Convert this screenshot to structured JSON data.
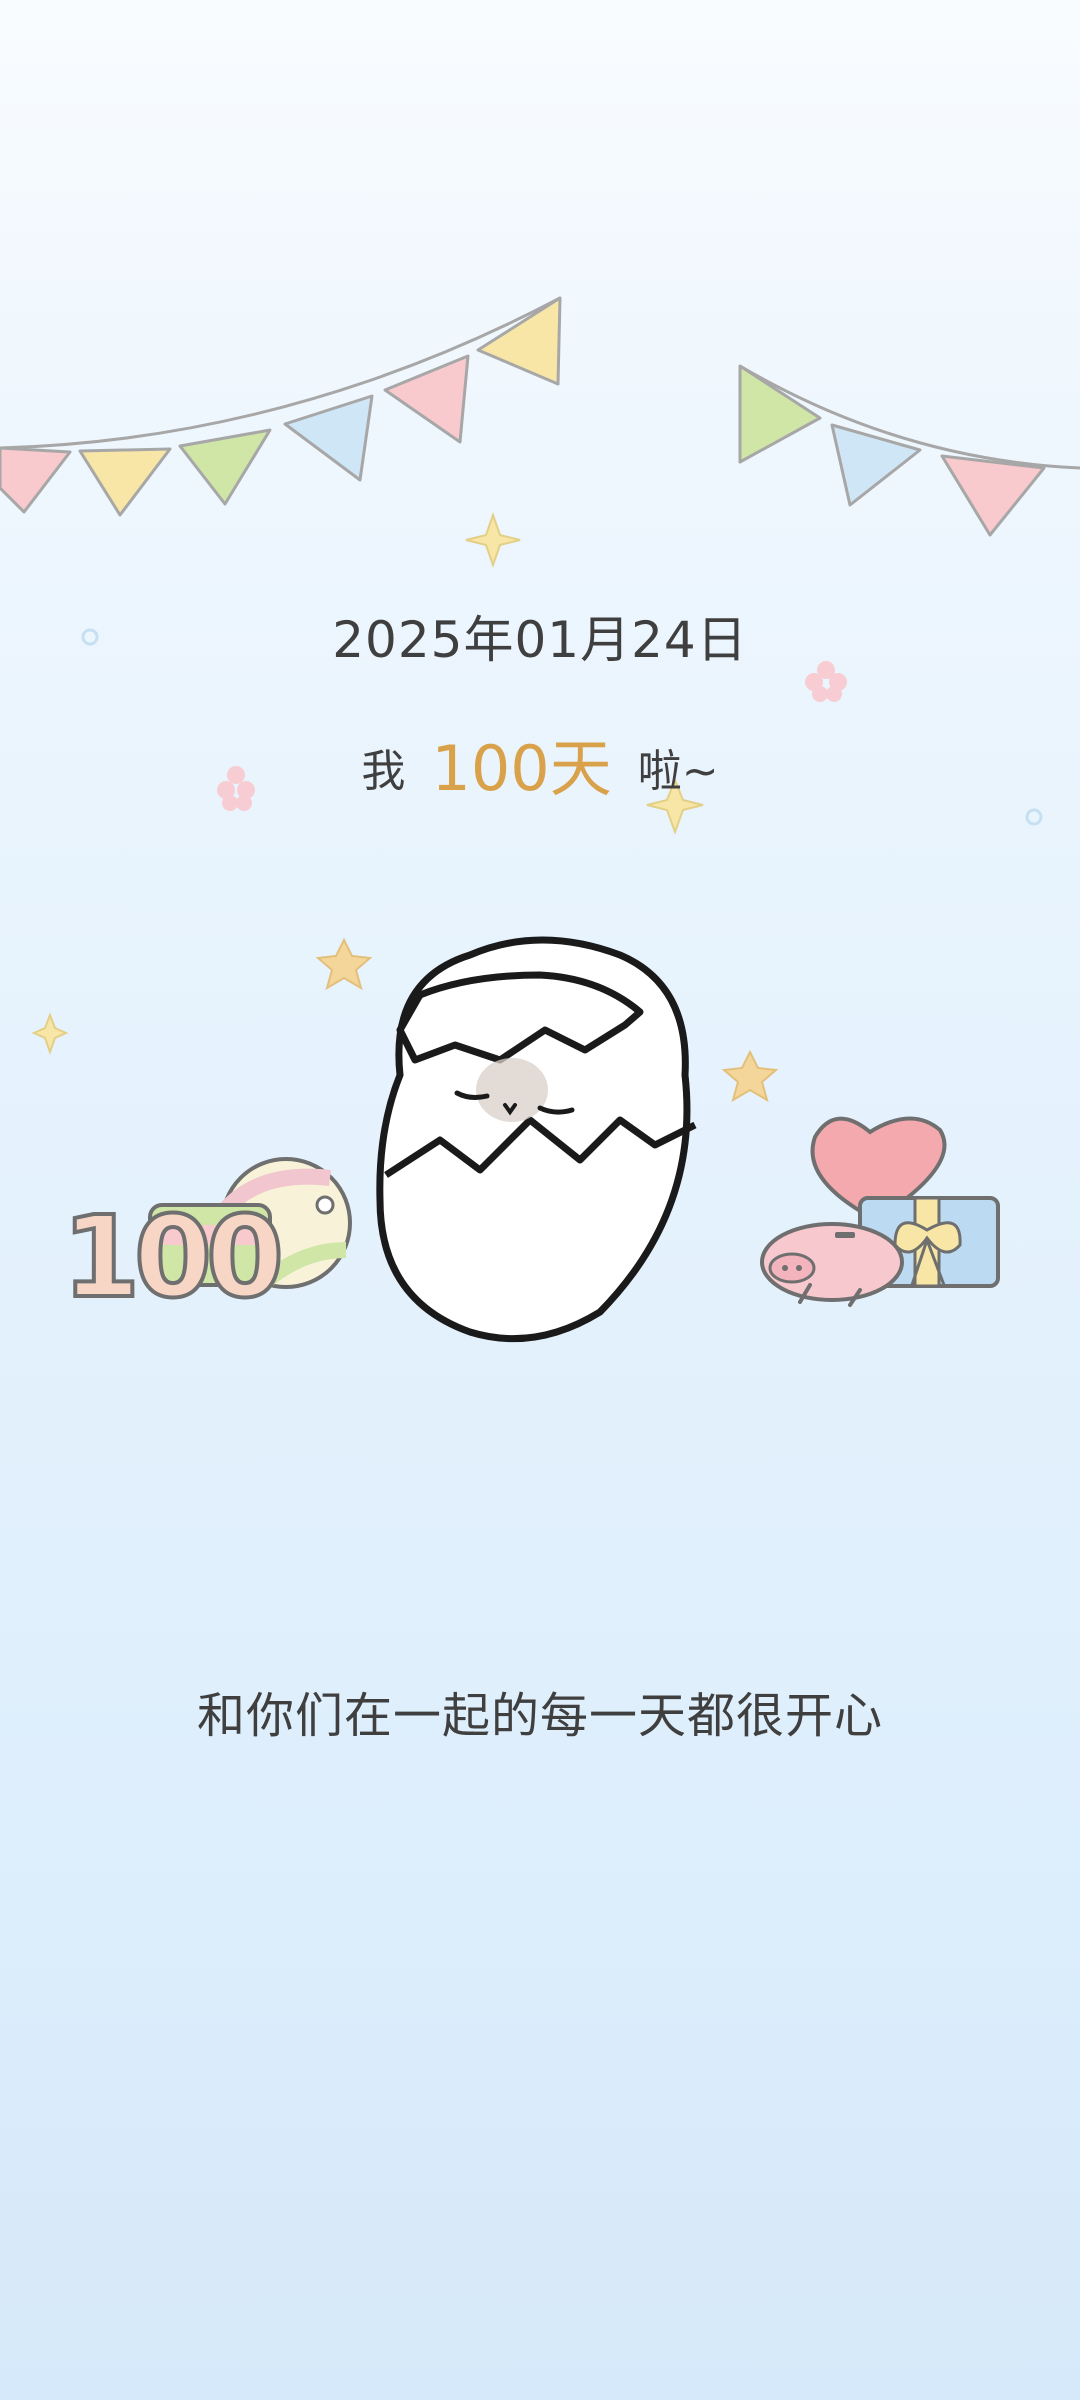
{
  "screen": {
    "date": "2025年01月24日",
    "headline": {
      "prefix": "我",
      "days": "100天",
      "suffix": "啦~"
    },
    "message": "和你们在一起的每一天都很开心"
  },
  "decorations": {
    "number_sign": "100",
    "icons": [
      "bunting-flags-icon",
      "star-icon",
      "flower-icon",
      "egg-chick-icon",
      "ball-icon",
      "heart-icon",
      "pig-icon",
      "gift-box-icon"
    ]
  },
  "colors": {
    "accent": "#d9a24a",
    "text": "#3f3f3f",
    "flag_pink": "#f8c9cd",
    "flag_yellow": "#f8e6a6",
    "flag_green": "#cfe6a7",
    "flag_blue": "#cfe6f7"
  }
}
